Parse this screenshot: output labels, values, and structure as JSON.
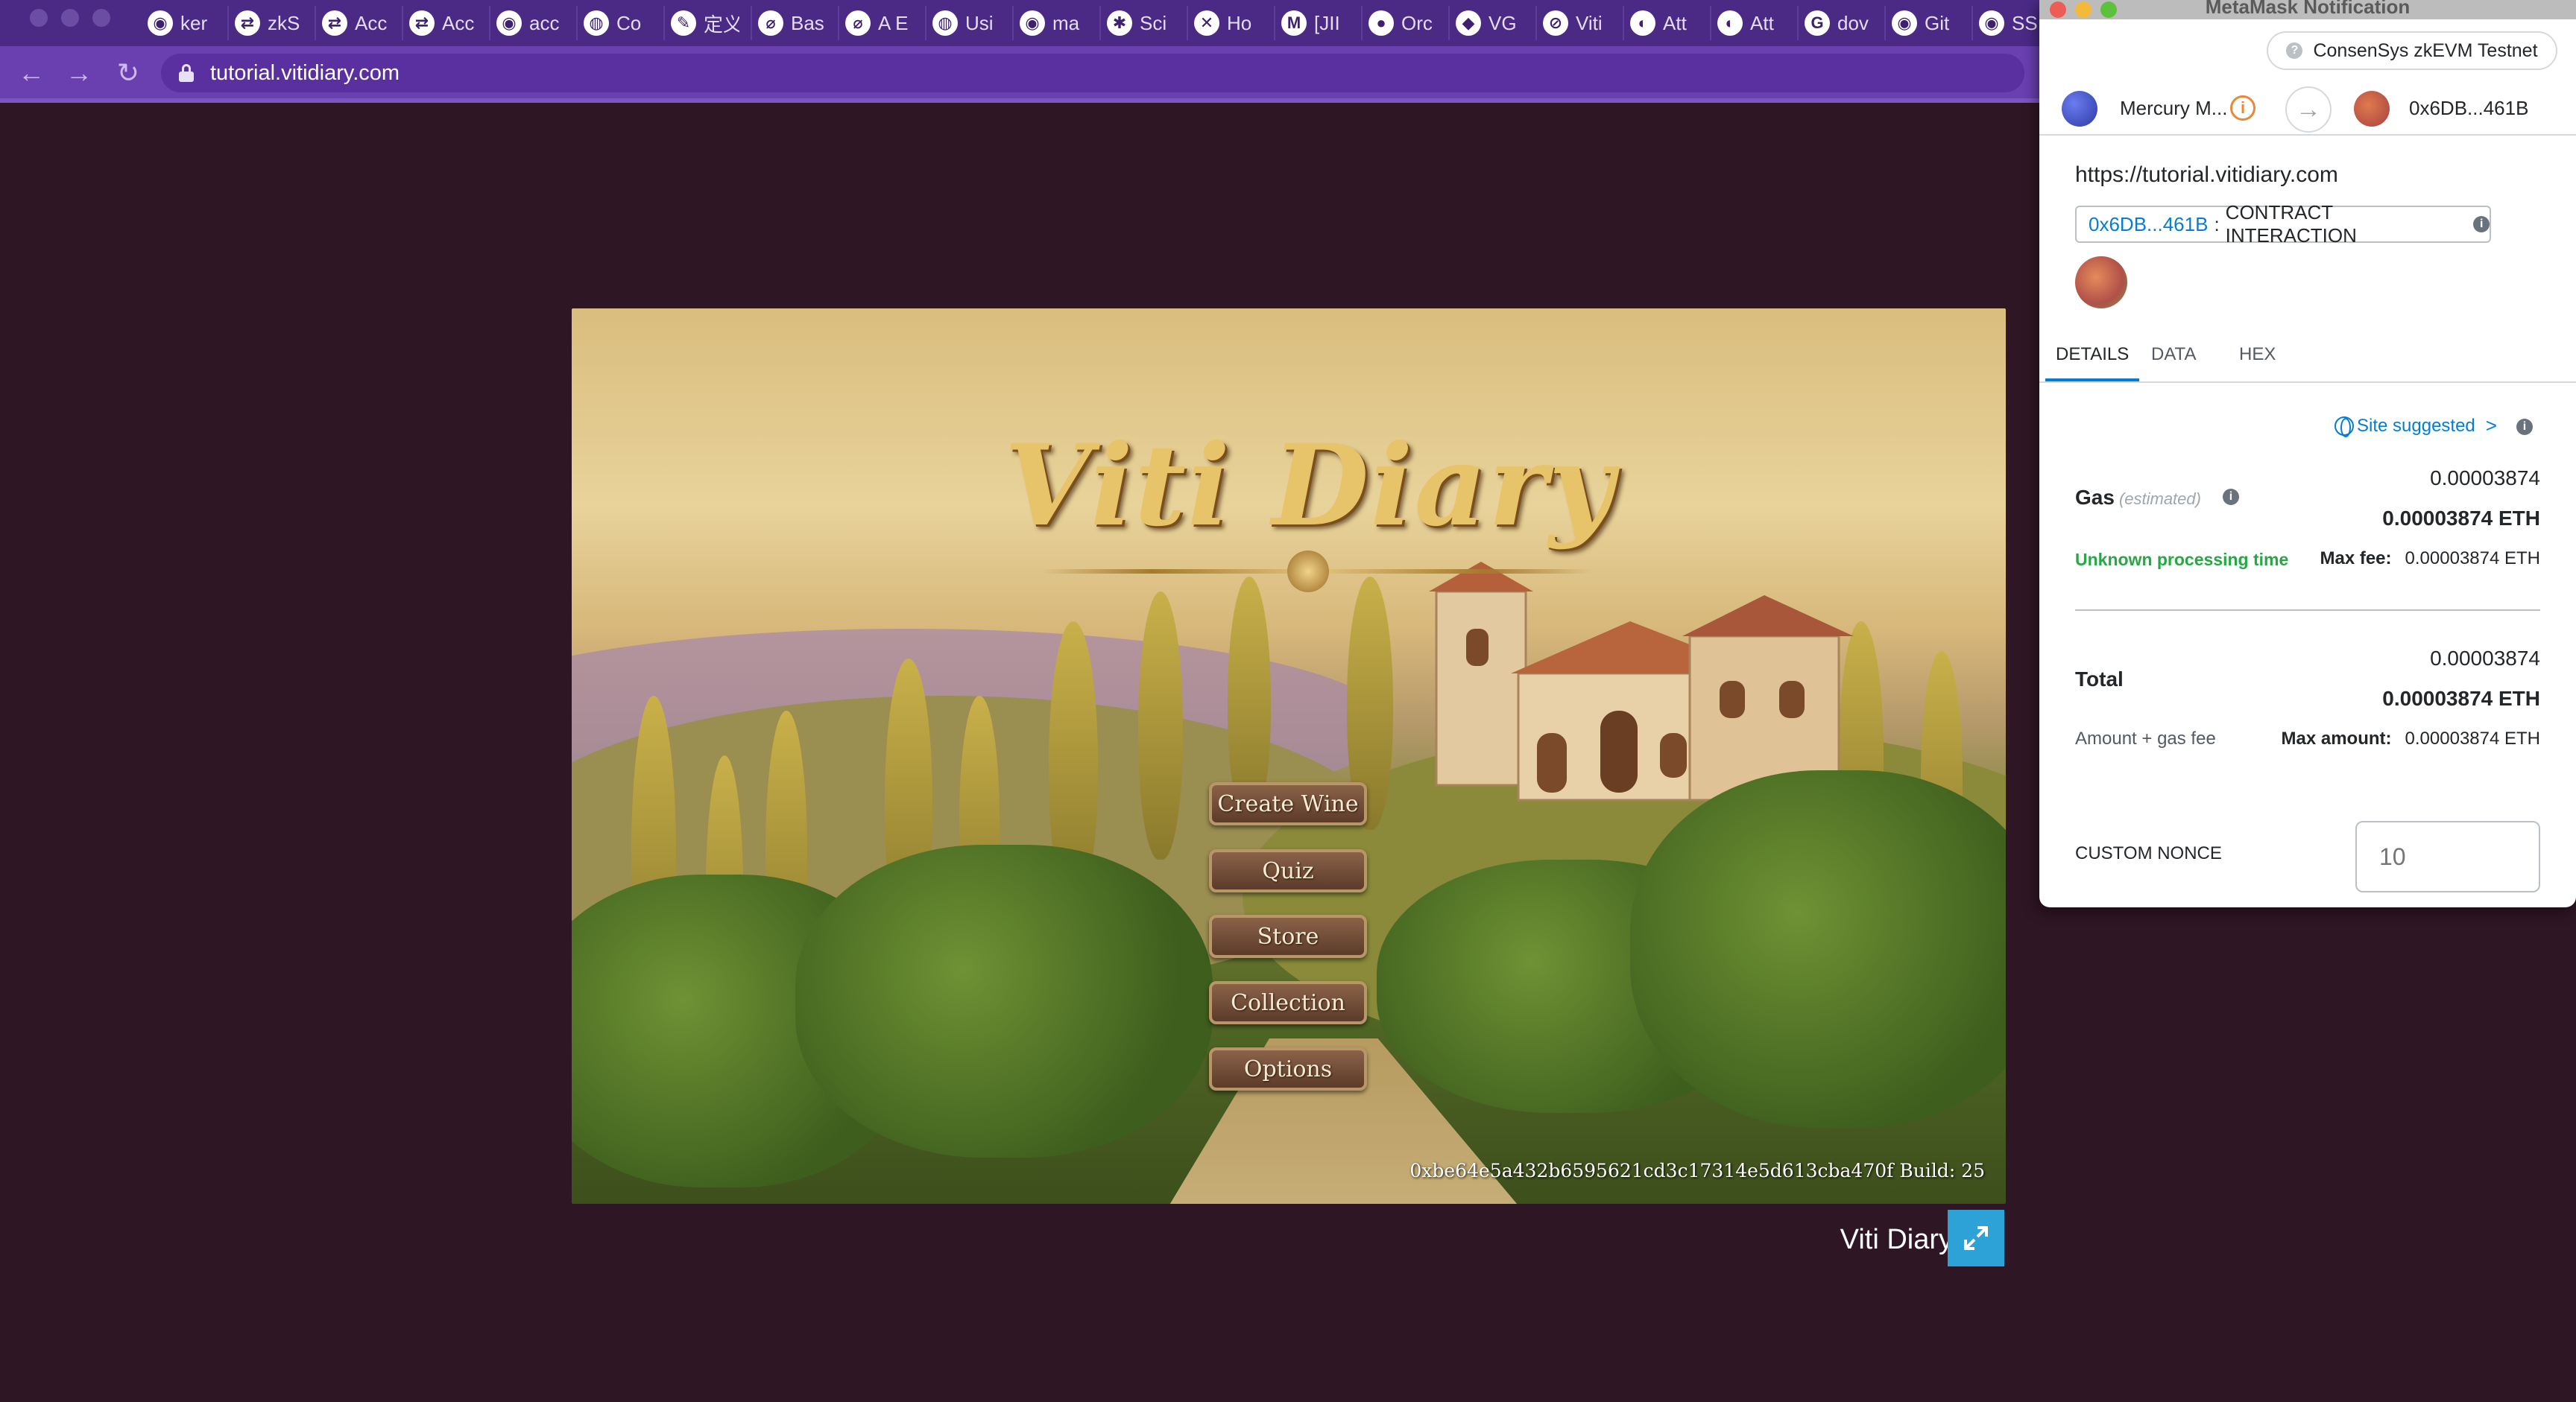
{
  "browser": {
    "tabs": [
      {
        "icon": "github-icon",
        "glyph": "◉",
        "label": "ker"
      },
      {
        "icon": "zksync-icon",
        "glyph": "⇄",
        "label": "zkS"
      },
      {
        "icon": "zksync-icon",
        "glyph": "⇄",
        "label": "Acc"
      },
      {
        "icon": "zksync-icon",
        "glyph": "⇄",
        "label": "Acc"
      },
      {
        "icon": "github-icon",
        "glyph": "◉",
        "label": "acc"
      },
      {
        "icon": "globe-icon",
        "glyph": "◍",
        "label": "Co"
      },
      {
        "icon": "doc-icon",
        "glyph": "✎",
        "label": "定义"
      },
      {
        "icon": "link-icon",
        "glyph": "⌀",
        "label": "Bas"
      },
      {
        "icon": "link-icon",
        "glyph": "⌀",
        "label": "A E"
      },
      {
        "icon": "globe-icon",
        "glyph": "◍",
        "label": "Usi"
      },
      {
        "icon": "github-icon",
        "glyph": "◉",
        "label": "ma"
      },
      {
        "icon": "palm-icon",
        "glyph": "✱",
        "label": "Sci"
      },
      {
        "icon": "confluence-icon",
        "glyph": "✕",
        "label": "Ho"
      },
      {
        "icon": "gmail-icon",
        "glyph": "M",
        "label": "[JII"
      },
      {
        "icon": "orca-icon",
        "glyph": "●",
        "label": "Orc"
      },
      {
        "icon": "jira-icon",
        "glyph": "◆",
        "label": "VG"
      },
      {
        "icon": "app-icon",
        "glyph": "⊘",
        "label": "Viti"
      },
      {
        "icon": "app-icon",
        "glyph": "◐",
        "label": "Att"
      },
      {
        "icon": "app-icon",
        "glyph": "◐",
        "label": "Att"
      },
      {
        "icon": "google-icon",
        "glyph": "G",
        "label": "dov"
      },
      {
        "icon": "github-icon",
        "glyph": "◉",
        "label": "Git"
      },
      {
        "icon": "github-icon",
        "glyph": "◉",
        "label": "SSI"
      }
    ],
    "nav": {
      "back": "←",
      "forward": "→",
      "reload": "↻"
    },
    "url": "tutorial.vitidiary.com"
  },
  "game": {
    "title": "Viti Diary",
    "menu": [
      "Create Wine",
      "Quiz",
      "Store",
      "Collection",
      "Options"
    ],
    "build_text": "0xbe64e5a432b6595621cd3c17314e5d613cba470f Build: 25",
    "footer_title": "Viti Diary",
    "fullscreen_glyph": "⤢"
  },
  "metamask": {
    "window_title": "MetaMask Notification",
    "network": "ConsenSys zkEVM Testnet",
    "network_glyph": "?",
    "from_account": "Mercury M...",
    "from_info_glyph": "i",
    "arrow_glyph": "→",
    "to_account": "0x6DB...461B",
    "origin": "https://tutorial.vitidiary.com",
    "method_address": "0x6DB...461B",
    "method_separator": ":",
    "method_name": "CONTRACT INTERACTION",
    "info_glyph": "i",
    "tabs": [
      "DETAILS",
      "DATA",
      "HEX"
    ],
    "active_tab": "DETAILS",
    "site_suggested": "Site suggested",
    "chevron": ">",
    "gas": {
      "label": "Gas",
      "sublabel": "(estimated)",
      "value": "0.00003874",
      "value_eth": "0.00003874 ETH",
      "processing": "Unknown processing time",
      "max_fee_label": "Max fee:",
      "max_fee_value": "0.00003874 ETH"
    },
    "total": {
      "label": "Total",
      "value": "0.00003874",
      "value_eth": "0.00003874 ETH",
      "note": "Amount + gas fee",
      "max_amount_label": "Max amount:",
      "max_amount_value": "0.00003874 ETH"
    },
    "nonce": {
      "label": "CUSTOM NONCE",
      "placeholder": "10"
    },
    "colors": {
      "link": "#037dd6",
      "success": "#28a745",
      "warning": "#e8893a"
    }
  }
}
